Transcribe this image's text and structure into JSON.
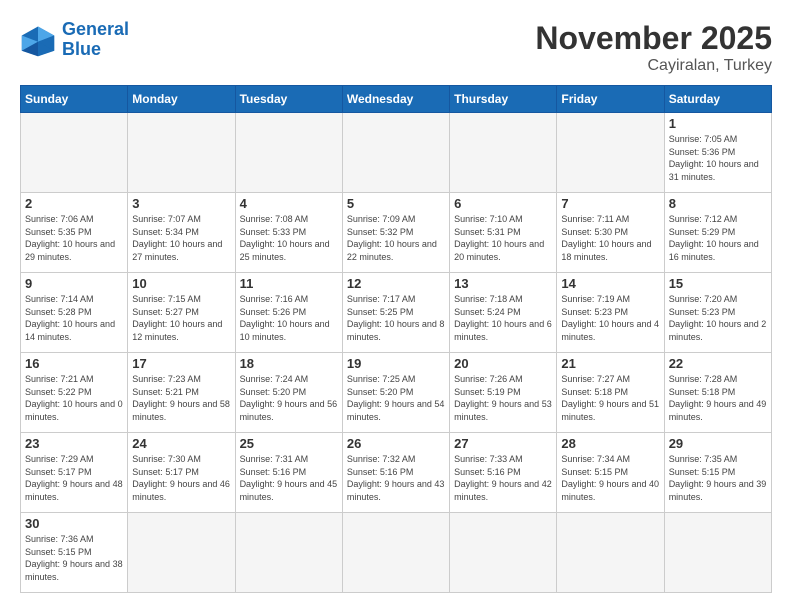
{
  "header": {
    "logo_general": "General",
    "logo_blue": "Blue",
    "month_title": "November 2025",
    "location": "Cayiralan, Turkey"
  },
  "weekdays": [
    "Sunday",
    "Monday",
    "Tuesday",
    "Wednesday",
    "Thursday",
    "Friday",
    "Saturday"
  ],
  "days": {
    "d1": {
      "n": "1",
      "sunrise": "7:05 AM",
      "sunset": "5:36 PM",
      "daylight": "10 hours and 31 minutes."
    },
    "d2": {
      "n": "2",
      "sunrise": "7:06 AM",
      "sunset": "5:35 PM",
      "daylight": "10 hours and 29 minutes."
    },
    "d3": {
      "n": "3",
      "sunrise": "7:07 AM",
      "sunset": "5:34 PM",
      "daylight": "10 hours and 27 minutes."
    },
    "d4": {
      "n": "4",
      "sunrise": "7:08 AM",
      "sunset": "5:33 PM",
      "daylight": "10 hours and 25 minutes."
    },
    "d5": {
      "n": "5",
      "sunrise": "7:09 AM",
      "sunset": "5:32 PM",
      "daylight": "10 hours and 22 minutes."
    },
    "d6": {
      "n": "6",
      "sunrise": "7:10 AM",
      "sunset": "5:31 PM",
      "daylight": "10 hours and 20 minutes."
    },
    "d7": {
      "n": "7",
      "sunrise": "7:11 AM",
      "sunset": "5:30 PM",
      "daylight": "10 hours and 18 minutes."
    },
    "d8": {
      "n": "8",
      "sunrise": "7:12 AM",
      "sunset": "5:29 PM",
      "daylight": "10 hours and 16 minutes."
    },
    "d9": {
      "n": "9",
      "sunrise": "7:14 AM",
      "sunset": "5:28 PM",
      "daylight": "10 hours and 14 minutes."
    },
    "d10": {
      "n": "10",
      "sunrise": "7:15 AM",
      "sunset": "5:27 PM",
      "daylight": "10 hours and 12 minutes."
    },
    "d11": {
      "n": "11",
      "sunrise": "7:16 AM",
      "sunset": "5:26 PM",
      "daylight": "10 hours and 10 minutes."
    },
    "d12": {
      "n": "12",
      "sunrise": "7:17 AM",
      "sunset": "5:25 PM",
      "daylight": "10 hours and 8 minutes."
    },
    "d13": {
      "n": "13",
      "sunrise": "7:18 AM",
      "sunset": "5:24 PM",
      "daylight": "10 hours and 6 minutes."
    },
    "d14": {
      "n": "14",
      "sunrise": "7:19 AM",
      "sunset": "5:23 PM",
      "daylight": "10 hours and 4 minutes."
    },
    "d15": {
      "n": "15",
      "sunrise": "7:20 AM",
      "sunset": "5:23 PM",
      "daylight": "10 hours and 2 minutes."
    },
    "d16": {
      "n": "16",
      "sunrise": "7:21 AM",
      "sunset": "5:22 PM",
      "daylight": "10 hours and 0 minutes."
    },
    "d17": {
      "n": "17",
      "sunrise": "7:23 AM",
      "sunset": "5:21 PM",
      "daylight": "9 hours and 58 minutes."
    },
    "d18": {
      "n": "18",
      "sunrise": "7:24 AM",
      "sunset": "5:20 PM",
      "daylight": "9 hours and 56 minutes."
    },
    "d19": {
      "n": "19",
      "sunrise": "7:25 AM",
      "sunset": "5:20 PM",
      "daylight": "9 hours and 54 minutes."
    },
    "d20": {
      "n": "20",
      "sunrise": "7:26 AM",
      "sunset": "5:19 PM",
      "daylight": "9 hours and 53 minutes."
    },
    "d21": {
      "n": "21",
      "sunrise": "7:27 AM",
      "sunset": "5:18 PM",
      "daylight": "9 hours and 51 minutes."
    },
    "d22": {
      "n": "22",
      "sunrise": "7:28 AM",
      "sunset": "5:18 PM",
      "daylight": "9 hours and 49 minutes."
    },
    "d23": {
      "n": "23",
      "sunrise": "7:29 AM",
      "sunset": "5:17 PM",
      "daylight": "9 hours and 48 minutes."
    },
    "d24": {
      "n": "24",
      "sunrise": "7:30 AM",
      "sunset": "5:17 PM",
      "daylight": "9 hours and 46 minutes."
    },
    "d25": {
      "n": "25",
      "sunrise": "7:31 AM",
      "sunset": "5:16 PM",
      "daylight": "9 hours and 45 minutes."
    },
    "d26": {
      "n": "26",
      "sunrise": "7:32 AM",
      "sunset": "5:16 PM",
      "daylight": "9 hours and 43 minutes."
    },
    "d27": {
      "n": "27",
      "sunrise": "7:33 AM",
      "sunset": "5:16 PM",
      "daylight": "9 hours and 42 minutes."
    },
    "d28": {
      "n": "28",
      "sunrise": "7:34 AM",
      "sunset": "5:15 PM",
      "daylight": "9 hours and 40 minutes."
    },
    "d29": {
      "n": "29",
      "sunrise": "7:35 AM",
      "sunset": "5:15 PM",
      "daylight": "9 hours and 39 minutes."
    },
    "d30": {
      "n": "30",
      "sunrise": "7:36 AM",
      "sunset": "5:15 PM",
      "daylight": "9 hours and 38 minutes."
    }
  }
}
